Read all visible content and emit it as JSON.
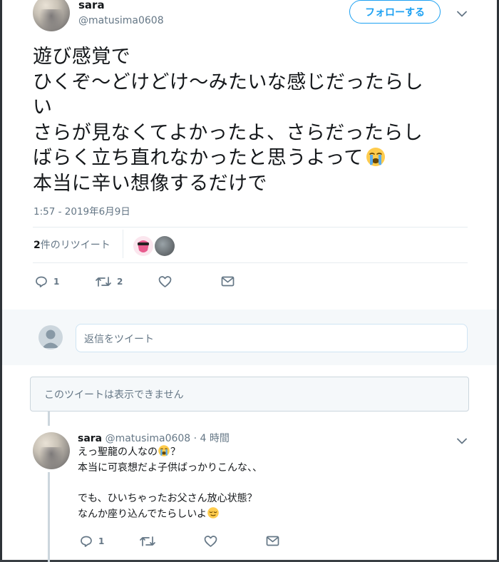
{
  "tweet": {
    "author_name": "sara",
    "author_handle": "@matusima0608",
    "follow_label": "フォローする",
    "lines": [
      "遊び感覚で",
      "ひくぞ～どけどけ～みたいな感じだったらし",
      "い",
      "さらが見なくてよかったよ、さらだったらし",
      "ばらく立ち直れなかったと思うよって",
      "本当に辛い想像するだけで"
    ],
    "emoji": "loudly-crying-face",
    "timestamp": "1:57 - 2019年6月9日",
    "retweet_count_number": "2",
    "retweet_count_suffix": "件のリツイート",
    "actions": {
      "reply_count": "1",
      "retweet_count": "2"
    }
  },
  "reply_composer": {
    "placeholder": "返信をツイート"
  },
  "unavailable_notice": "このツイートは表示できません",
  "reply_tweet": {
    "author_name": "sara",
    "author_handle": "@matusima0608",
    "time": "· 4 時間",
    "lines": [
      "えっ聖龍の人なの",
      "？",
      "本当に可哀想だよ子供ばっかりこんな、、",
      "",
      "でも、ひいちゃったお父さん放心状態？",
      "なんか座り込んでたらしいよ"
    ],
    "actions": {
      "reply_count": "1"
    }
  },
  "colors": {
    "accent": "#1da1f2",
    "muted": "#657786",
    "text": "#14171a",
    "border": "#e6ecf0"
  }
}
